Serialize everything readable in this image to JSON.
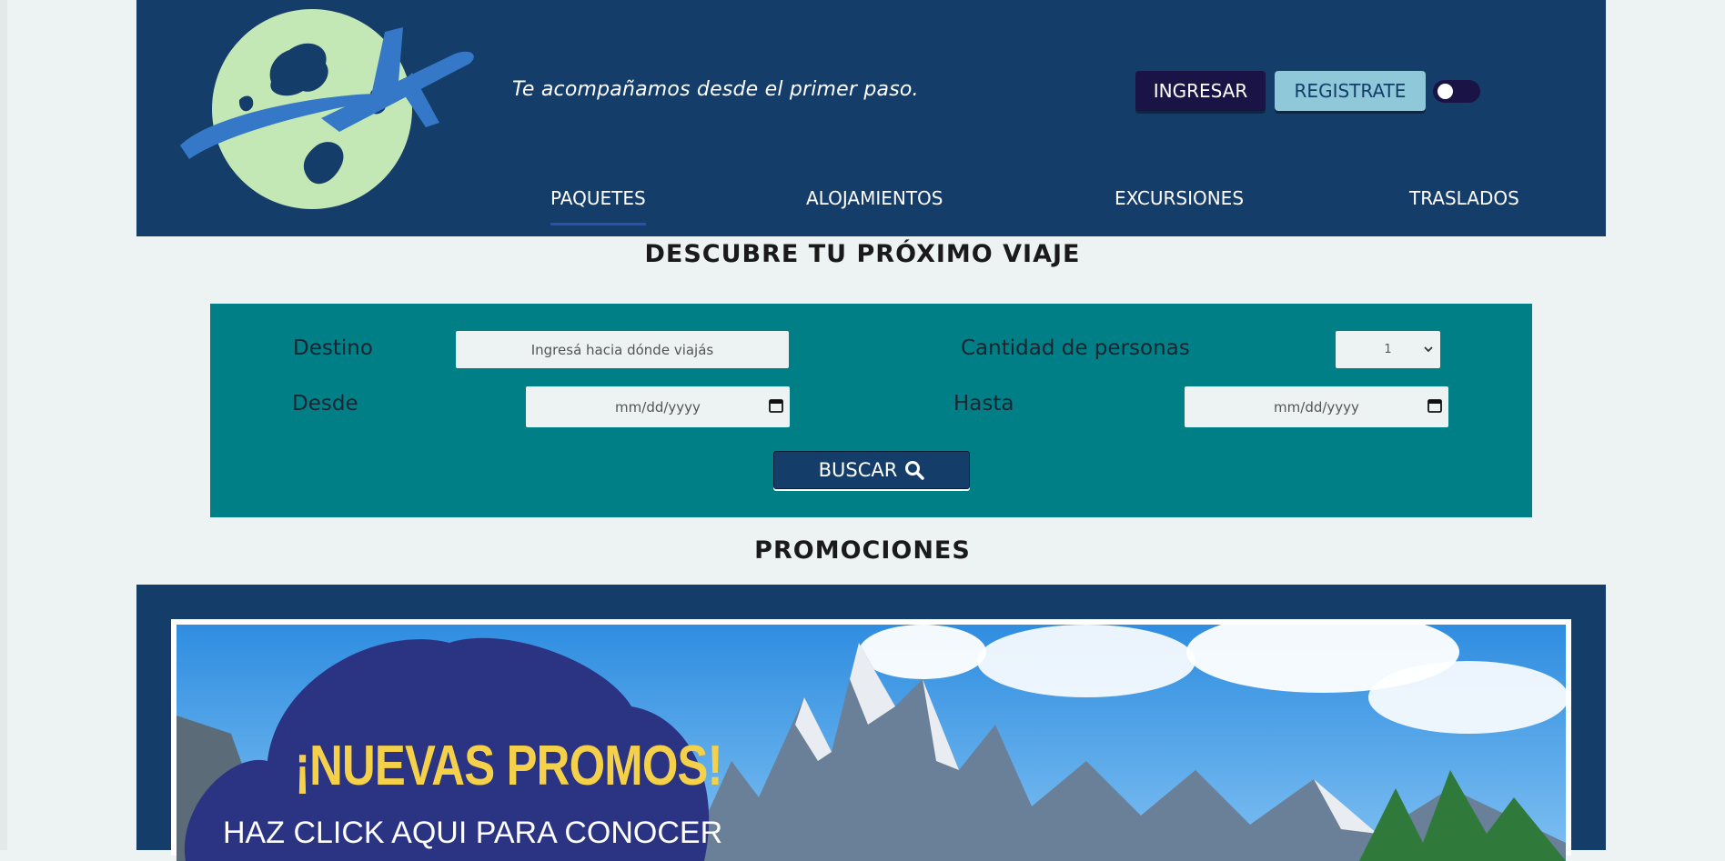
{
  "header": {
    "tagline": "Te acompañamos desde el primer paso.",
    "login_label": "INGRESAR",
    "register_label": "REGISTRATE",
    "theme_toggle_on": false
  },
  "nav": {
    "items": [
      {
        "label": "PAQUETES",
        "active": true
      },
      {
        "label": "ALOJAMIENTOS",
        "active": false
      },
      {
        "label": "EXCURSIONES",
        "active": false
      },
      {
        "label": "TRASLADOS",
        "active": false
      }
    ]
  },
  "search": {
    "title": "DESCUBRE TU PRÓXIMO VIAJE",
    "destino_label": "Destino",
    "destino_placeholder": "Ingresá hacia dónde viajás",
    "personas_label": "Cantidad de personas",
    "personas_value": "1",
    "desde_label": "Desde",
    "desde_placeholder": "mm/dd/yyyy",
    "hasta_label": "Hasta",
    "hasta_placeholder": "mm/dd/yyyy",
    "button_label": "BUSCAR"
  },
  "promos": {
    "title": "PROMOCIONES",
    "banner_headline": "¡NUEVAS PROMOS!",
    "banner_subtext": "HAZ CLICK AQUI PARA CONOCER"
  },
  "colors": {
    "header_bg": "#143d69",
    "panel_bg": "#017f87",
    "page_bg": "#edf2f2",
    "accent_dark": "#1a1446",
    "accent_light": "#8ec8d9",
    "promo_yellow": "#f5d14a"
  },
  "icons": {
    "logo": "globe-airplane-logo",
    "search": "search-icon",
    "calendar": "calendar-icon",
    "chevron": "chevron-down-icon"
  }
}
